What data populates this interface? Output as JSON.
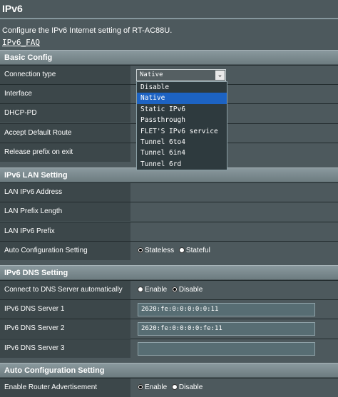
{
  "header": {
    "title": "IPv6",
    "description": "Configure the IPv6 Internet setting of RT-AC88U.",
    "faq_link": "IPv6_FAQ"
  },
  "basic_config": {
    "heading": "Basic Config",
    "connection_type_label": "Connection type",
    "connection_type_value": "Native",
    "interface_label": "Interface",
    "dhcp_pd_label": "DHCP-PD",
    "accept_default_route_label": "Accept Default Route",
    "release_prefix_label": "Release prefix on exit",
    "options": [
      "Disable",
      "Native",
      "Static IPv6",
      "Passthrough",
      "FLET'S IPv6 service",
      "Tunnel 6to4",
      "Tunnel 6in4",
      "Tunnel 6rd"
    ],
    "selected_index": 1
  },
  "lan_setting": {
    "heading": "IPv6 LAN Setting",
    "lan_address_label": "LAN IPv6 Address",
    "lan_prefix_length_label": "LAN Prefix Length",
    "lan_prefix_label": "LAN IPv6 Prefix",
    "auto_config_label": "Auto Configuration Setting",
    "stateless_label": "Stateless",
    "stateful_label": "Stateful",
    "selected": "Stateless"
  },
  "dns_setting": {
    "heading": "IPv6 DNS Setting",
    "auto_dns_label": "Connect to DNS Server automatically",
    "enable_label": "Enable",
    "disable_label": "Disable",
    "selected": "Disable",
    "dns1_label": "IPv6 DNS Server 1",
    "dns1_value": "2620:fe:0:0:0:0:0:11",
    "dns2_label": "IPv6 DNS Server 2",
    "dns2_value": "2620:fe:0:0:0:0:fe:11",
    "dns3_label": "IPv6 DNS Server 3",
    "dns3_value": ""
  },
  "auto_config": {
    "heading": "Auto Configuration Setting",
    "router_adv_label": "Enable Router Advertisement",
    "enable_label": "Enable",
    "disable_label": "Disable",
    "selected": "Enable"
  }
}
